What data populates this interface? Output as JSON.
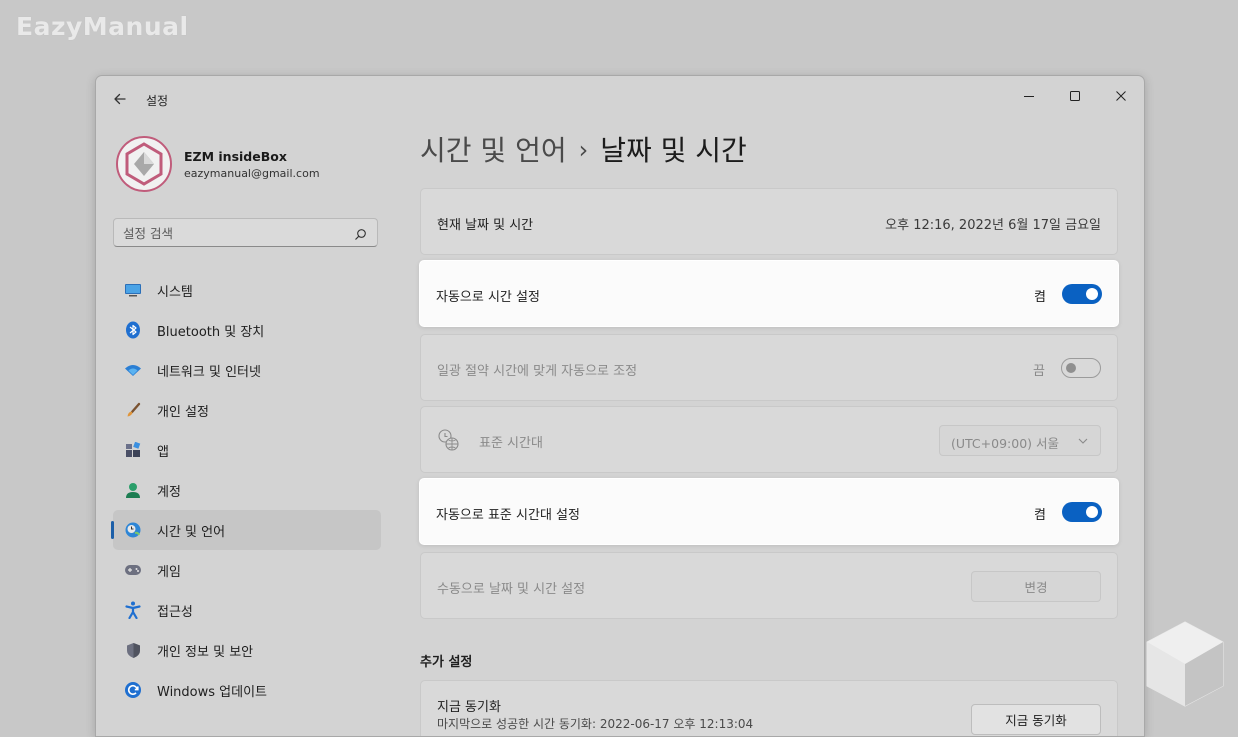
{
  "watermark": "EazyManual",
  "window": {
    "title": "설정",
    "colors": {
      "accent": "#0a61c2",
      "avatar_border": "#c05c7b"
    }
  },
  "profile": {
    "name": "EZM insideBox",
    "email": "eazymanual@gmail.com"
  },
  "search": {
    "placeholder": "설정 검색"
  },
  "sidebar": {
    "items": [
      {
        "label": "시스템",
        "icon": "monitor-icon"
      },
      {
        "label": "Bluetooth 및 장치",
        "icon": "bluetooth-icon"
      },
      {
        "label": "네트워크 및 인터넷",
        "icon": "wifi-icon"
      },
      {
        "label": "개인 설정",
        "icon": "brush-icon"
      },
      {
        "label": "앱",
        "icon": "apps-icon"
      },
      {
        "label": "계정",
        "icon": "person-icon"
      },
      {
        "label": "시간 및 언어",
        "icon": "globe-clock-icon",
        "active": true
      },
      {
        "label": "게임",
        "icon": "gamepad-icon"
      },
      {
        "label": "접근성",
        "icon": "accessibility-icon"
      },
      {
        "label": "개인 정보 및 보안",
        "icon": "shield-icon"
      },
      {
        "label": "Windows 업데이트",
        "icon": "update-icon"
      }
    ]
  },
  "breadcrumb": {
    "parent": "시간 및 언어",
    "separator": "›",
    "current": "날짜 및 시간"
  },
  "settings": {
    "current": {
      "label": "현재 날짜 및 시간",
      "value": "오후 12:16, 2022년 6월 17일 금요일"
    },
    "auto_time": {
      "label": "자동으로 시간 설정",
      "state": "켬"
    },
    "dst": {
      "label": "일광 절약 시간에 맞게 자동으로 조정",
      "state": "끔"
    },
    "timezone": {
      "label": "표준 시간대",
      "value": "(UTC+09:00) 서울"
    },
    "auto_timezone": {
      "label": "자동으로 표준 시간대 설정",
      "state": "켬"
    },
    "manual": {
      "label": "수동으로 날짜 및 시간 설정",
      "button": "변경"
    }
  },
  "additional": {
    "title": "추가 설정",
    "sync": {
      "title": "지금 동기화",
      "subtitle": "마지막으로 성공한 시간 동기화: 2022-06-17 오후 12:13:04",
      "button": "지금 동기화"
    }
  }
}
